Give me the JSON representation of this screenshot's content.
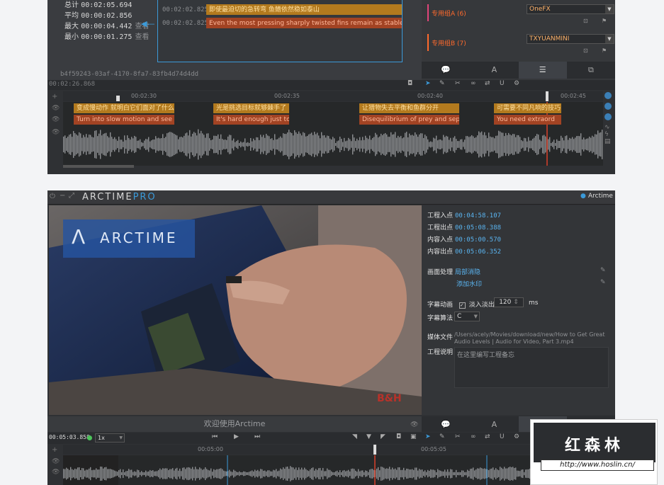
{
  "top": {
    "stats": [
      {
        "label": "总计",
        "value": "00:02:05.694",
        "link": ""
      },
      {
        "label": "平均",
        "value": "00:00:02.856",
        "link": ""
      },
      {
        "label": "最大",
        "value": "00:00:04.442",
        "link": "查看"
      },
      {
        "label": "最小",
        "value": "00:00:01.275",
        "link": "查看"
      }
    ],
    "qrows": [
      {
        "time": "00:02:02.825",
        "text": "即使最迫切的急转弯 鱼鳍依然稳如泰山"
      },
      {
        "time": "00:02:02.825",
        "text": "Even the most pressing sharply twisted fins remain as stable ..."
      }
    ],
    "uuid": "b4f59243-03af-4170-8fa7-83fb4d74d4dd",
    "groups": [
      {
        "label": "专用组A (6)",
        "value": "OneFX"
      },
      {
        "label": "专用组B (7)",
        "value": "TXYUANMINI"
      }
    ],
    "panel_tabs": [
      "💬",
      "A",
      "☰",
      "⧉"
    ],
    "toolbar_time": "00:02:26.868",
    "ruler_ticks": [
      "00:02:30",
      "00:02:35",
      "00:02:40",
      "00:02:45"
    ],
    "subs_cn": [
      "变成慢动作 就明白它们面对了什么",
      "光是挑选目标就够棘手了",
      "让猎物失去平衡和鱼群分开",
      "可需要不同凡响的技巧"
    ],
    "subs_en": [
      "Turn into slow motion and see",
      "It's hard enough just to",
      "Disequilibrium of prey and sep",
      "You need extraord"
    ]
  },
  "bottom": {
    "app_title": "ARCTIME",
    "app_title_pro": "PRO",
    "account_label": "Arctime",
    "logo_text": "ARCTIME",
    "video_watermark": "B&H",
    "welcome": "欢迎使用Arctime",
    "props": {
      "proj_in": {
        "label": "工程入点",
        "value": "00:04:58.107"
      },
      "proj_out": {
        "label": "工程出点",
        "value": "00:05:08.388"
      },
      "content_in": {
        "label": "内容入点",
        "value": "00:05:00.570"
      },
      "content_out": {
        "label": "内容出点",
        "value": "00:05:06.352"
      },
      "image_label": "画面处理",
      "image_link1": "局部消隐",
      "image_link2": "添加水印",
      "anim_label": "字幕动画",
      "anim_check": "淡入淡出",
      "anim_ms": "120",
      "anim_unit": "ms",
      "algo_label": "字幕算法",
      "algo_value": "C",
      "media_label": "媒体文件",
      "media_value": "/Users/acely/Movies/download/new/How to Get Great Audio Levels | Audio for Video, Part 3.mp4",
      "notes_label": "工程说明",
      "notes_placeholder": "在这里编写工程备忘"
    },
    "timecode": "00:05:03.858",
    "speed": "1x",
    "ruler_ticks": [
      "00:05:00",
      "00:05:05"
    ]
  },
  "watermark": {
    "title": "红森林",
    "url": "http://www.hoslin.cn/"
  },
  "colors": {
    "accent": "#5ab4f0",
    "orange": "#ff6a2c",
    "playhead": "#d9402a"
  }
}
